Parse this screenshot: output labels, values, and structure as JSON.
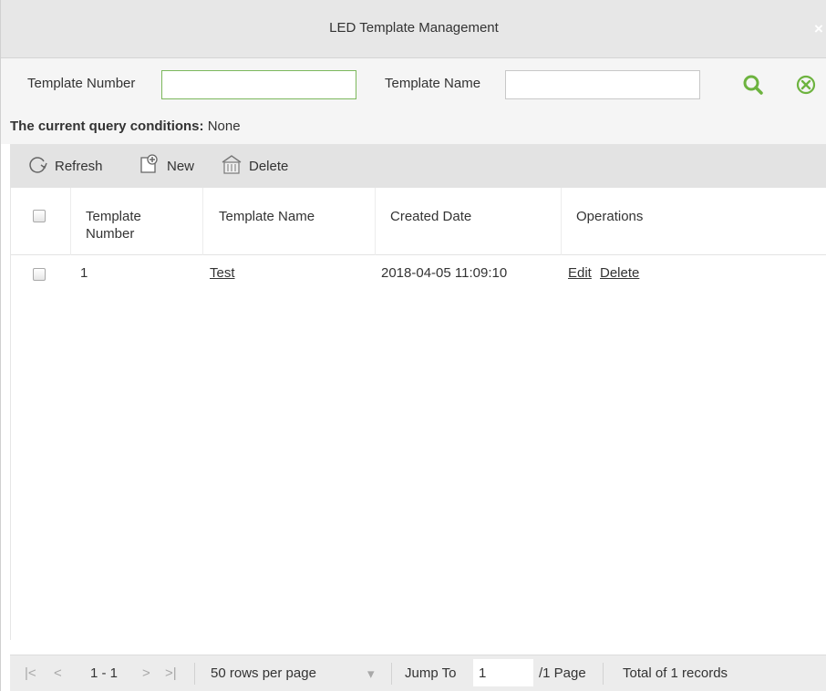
{
  "window": {
    "title": "LED Template Management",
    "close_symbol": "×"
  },
  "filter": {
    "number_label": "Template Number",
    "number_value": "",
    "name_label": "Template Name",
    "name_value": "",
    "search_icon": "search-icon",
    "clear_icon": "clear-icon",
    "accent_color": "#6db33f"
  },
  "query": {
    "label": "The current query conditions:",
    "value": "None"
  },
  "toolbar": {
    "refresh_label": "Refresh",
    "new_label": "New",
    "delete_label": "Delete"
  },
  "grid": {
    "columns": {
      "number_line1": "Template",
      "number_line2": "Number",
      "name": "Template Name",
      "created": "Created Date",
      "operations": "Operations"
    },
    "rows": [
      {
        "number": "1",
        "name": "Test",
        "created": "2018-04-05 11:09:10",
        "edit": "Edit",
        "delete": "Delete"
      }
    ]
  },
  "pager": {
    "first": "|<",
    "prev": "<",
    "range": "1 - 1",
    "next": ">",
    "last": ">|",
    "rows_per_page": "50 rows per page",
    "dropdown_arrow": "▾",
    "jump_label": "Jump To",
    "jump_value": "1",
    "page_total": "/1 Page",
    "records": "Total of 1 records"
  }
}
